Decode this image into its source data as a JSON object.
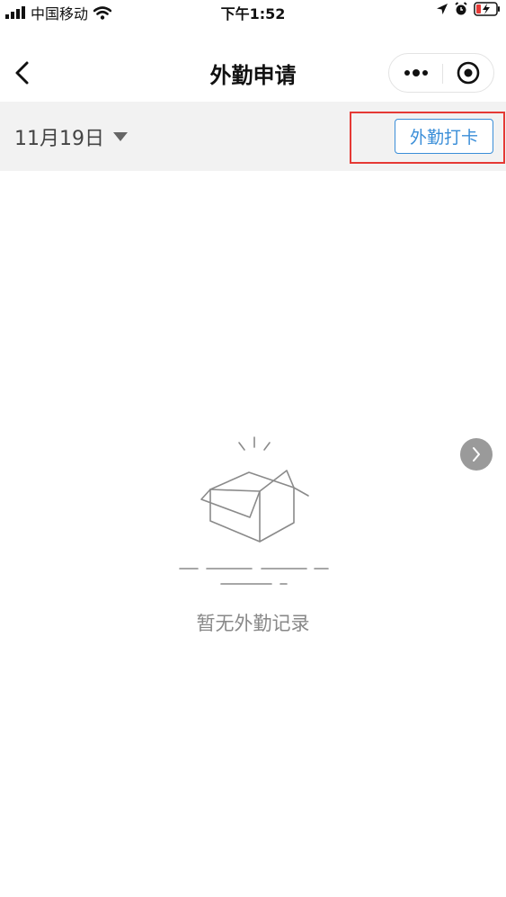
{
  "status_bar": {
    "carrier": "中国移动",
    "time": "下午1:52"
  },
  "nav": {
    "title": "外勤申请"
  },
  "filter": {
    "date": "11月19日",
    "checkin_button": "外勤打卡"
  },
  "empty_state": {
    "message": "暂无外勤记录"
  },
  "colors": {
    "accent": "#3a8ed8",
    "highlight": "#e53935",
    "filter_bg": "#f2f2f2"
  }
}
